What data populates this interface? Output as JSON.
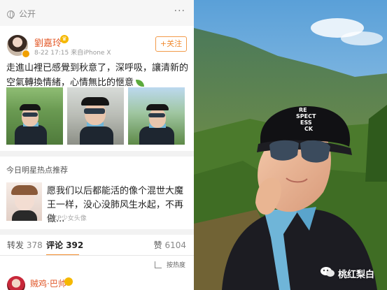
{
  "left": {
    "public_label": "公开",
    "post": {
      "username": "劉嘉玲",
      "meta": "8-22 17:15  来自iPhone X",
      "follow_label": "+关注",
      "text": "走進山裡已感覺到秋意了，深呼吸，讓清新的空氣轉換情緒，心情無比的愜意",
      "photos": [
        "photo-1",
        "photo-2",
        "photo-3"
      ]
    },
    "recommend": {
      "title": "今日明星热点推荐",
      "text": "愿我们以后都能活的像个混世大魔王一样，没心没肺风生水起，不再做...",
      "source": "@CP少女头像"
    },
    "tabs": {
      "repost_label": "转发",
      "repost_count": "378",
      "comment_label": "评论",
      "comment_count": "392",
      "like_label": "赞",
      "like_count": "6104"
    },
    "sort_label": "按热度",
    "comment": {
      "username": "贼鸡·巴帅"
    }
  },
  "right": {
    "cap_text": "RE\nSPECT\nESS\nCK",
    "watermark": "桃红梨白"
  },
  "colors": {
    "accent_orange": "#f08a30",
    "name_orange": "#e35a2a"
  }
}
